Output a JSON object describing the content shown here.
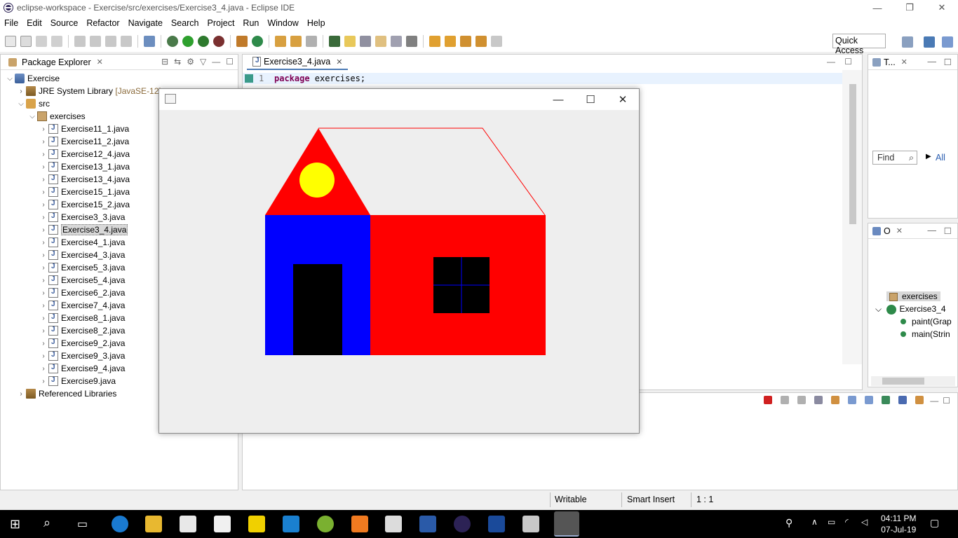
{
  "window": {
    "title": "eclipse-workspace - Exercise/src/exercises/Exercise3_4.java - Eclipse IDE",
    "controls": [
      "—",
      "❐",
      "✕"
    ]
  },
  "menu": [
    "File",
    "Edit",
    "Source",
    "Refactor",
    "Navigate",
    "Search",
    "Project",
    "Run",
    "Window",
    "Help"
  ],
  "toolbar": {
    "quick_access": "Quick Access"
  },
  "package_explorer": {
    "tab_label": "Package Explorer",
    "project": "Exercise",
    "jre": {
      "label": "JRE System Library",
      "version": "[JavaSE-12]"
    },
    "src": "src",
    "package": "exercises",
    "files": [
      "Exercise11_1.java",
      "Exercise11_2.java",
      "Exercise12_4.java",
      "Exercise13_1.java",
      "Exercise13_4.java",
      "Exercise15_1.java",
      "Exercise15_2.java",
      "Exercise3_3.java",
      "Exercise3_4.java",
      "Exercise4_1.java",
      "Exercise4_3.java",
      "Exercise5_3.java",
      "Exercise5_4.java",
      "Exercise6_2.java",
      "Exercise7_4.java",
      "Exercise8_1.java",
      "Exercise8_2.java",
      "Exercise9_2.java",
      "Exercise9_3.java",
      "Exercise9_4.java",
      "Exercise9.java"
    ],
    "selected_file": "Exercise3_4.java",
    "referenced_libraries": "Referenced Libraries"
  },
  "editor": {
    "tab_label": "Exercise3_4.java",
    "line_number": "1",
    "code_keyword": "package",
    "code_rest": " exercises;"
  },
  "task_panel": {
    "tab_label": "T...",
    "find": "Find",
    "all": "All"
  },
  "outline": {
    "tab_label": "O",
    "package": "exercises",
    "class": "Exercise3_4",
    "methods": [
      "paint(Grap",
      "main(Strin"
    ]
  },
  "status": {
    "writable": "Writable",
    "insert_mode": "Smart Insert",
    "position": "1 : 1"
  },
  "taskbar": {
    "time": "04:11 PM",
    "date": "07-Jul-19"
  },
  "swing_window": {
    "controls": [
      "—",
      "☐",
      "✕"
    ]
  },
  "colors": {
    "roof_left": "#ff0000",
    "sun": "#ffff00",
    "left_wall": "#0000ff",
    "right_wall": "#ff0000",
    "door": "#000000",
    "window": "#000000",
    "window_cross": "#0000ff",
    "roof_right_outline": "#ff0000",
    "panel_bg": "#eeeeee"
  }
}
